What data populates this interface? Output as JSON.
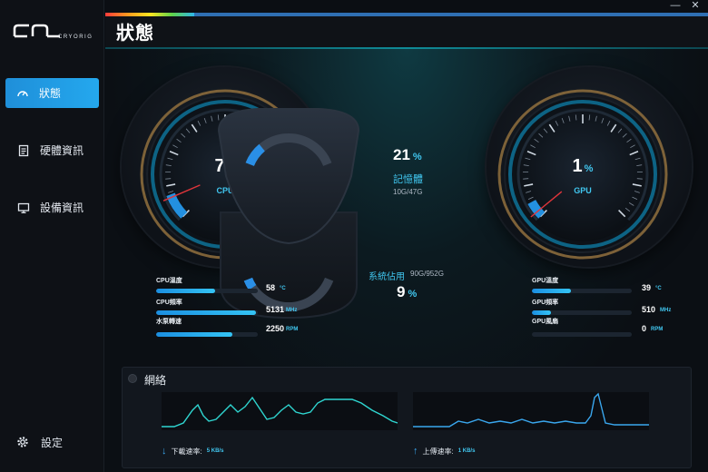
{
  "app": {
    "logo_text": "CRYORIG"
  },
  "header": {
    "title": "狀態",
    "minimize": "—",
    "close": "✕"
  },
  "sidebar": {
    "items": [
      {
        "label": "狀態",
        "icon": "gauge-icon",
        "active": true
      },
      {
        "label": "硬體資訊",
        "icon": "document-icon",
        "active": false
      },
      {
        "label": "設備資訊",
        "icon": "monitor-icon",
        "active": false
      }
    ],
    "settings_label": "設定"
  },
  "cpu": {
    "value": "7",
    "unit": "%",
    "label": "CPU",
    "stats": [
      {
        "label": "CPU溫度",
        "value": "58",
        "unit": "°C",
        "fill": 0.58
      },
      {
        "label": "CPU頻率",
        "value": "5131",
        "unit": "MHz",
        "fill": 0.98
      },
      {
        "label": "水泵轉速",
        "value": "2250",
        "unit": "RPM",
        "fill": 0.75
      }
    ]
  },
  "memory": {
    "value": "21",
    "unit": "%",
    "label": "記憶體",
    "detail": "10G/47G",
    "fill": 0.21
  },
  "system": {
    "label": "系統佔用",
    "detail": "90G/952G",
    "value": "9",
    "unit": "%",
    "fill": 0.09
  },
  "gpu": {
    "value": "1",
    "unit": "%",
    "label": "GPU",
    "stats": [
      {
        "label": "GPU溫度",
        "value": "39",
        "unit": "°C",
        "fill": 0.39
      },
      {
        "label": "GPU頻率",
        "value": "510",
        "unit": "MHz",
        "fill": 0.19
      },
      {
        "label": "GPU風扇",
        "value": "0",
        "unit": "RPM",
        "fill": 0.0
      }
    ]
  },
  "network": {
    "title": "網絡",
    "download_label": "下載速率:",
    "download_rate": "5 KB/s",
    "upload_label": "上傳速率:",
    "upload_rate": "1 KB/s"
  },
  "colors": {
    "accent": "#24a8ee",
    "cyan": "#41c7f0",
    "background": "#0b0e13"
  }
}
